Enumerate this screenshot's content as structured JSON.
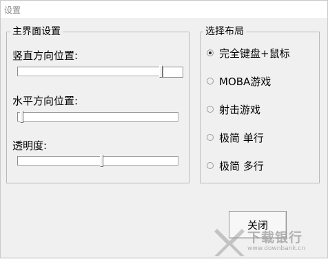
{
  "window": {
    "title": "设置"
  },
  "main_group": {
    "caption": "主界面设置",
    "vertical": {
      "label": "竖直方向位置:",
      "value_pct": 95
    },
    "horizontal": {
      "label": "水平方向位置:",
      "value_pct": 2
    },
    "opacity": {
      "label": "透明度:",
      "value_pct": 51
    }
  },
  "layout_group": {
    "caption": "选择布局",
    "options": [
      {
        "label": "完全键盘+鼠标",
        "checked": true
      },
      {
        "label": "MOBA游戏",
        "checked": false
      },
      {
        "label": "射击游戏",
        "checked": false
      },
      {
        "label": "极简 单行",
        "checked": false
      },
      {
        "label": "极简 多行",
        "checked": false
      }
    ]
  },
  "buttons": {
    "close_label": "关闭"
  },
  "watermark": {
    "brand": "下载银行",
    "url": "www.downbank.cn"
  }
}
